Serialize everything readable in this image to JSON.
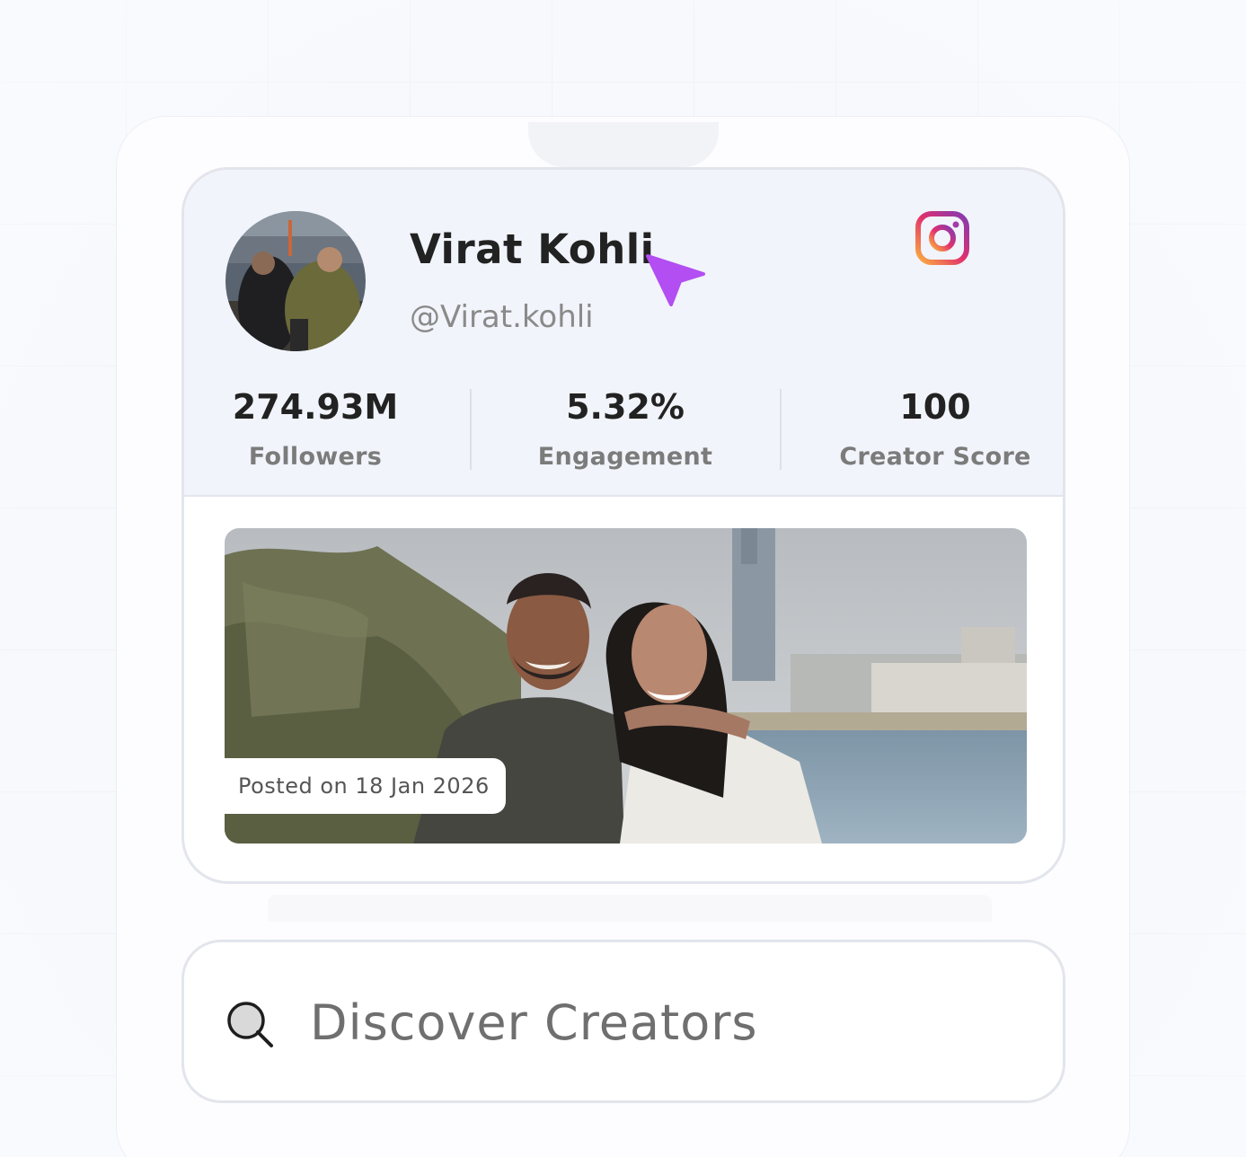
{
  "profile": {
    "name": "Virat Kohli",
    "handle": "@Virat.kohli",
    "platform_icon": "instagram-icon"
  },
  "stats": [
    {
      "value": "274.93M",
      "label": "Followers"
    },
    {
      "value": "5.32%",
      "label": "Engagement"
    },
    {
      "value": "100",
      "label": "Creator Score"
    }
  ],
  "post": {
    "posted_label": "Posted on 18 Jan 2026"
  },
  "search": {
    "placeholder": "Discover Creators",
    "icon": "search-icon"
  },
  "colors": {
    "cursor": "#b24ef2",
    "card_header_bg": "#f1f4fa",
    "instagram_gradient": [
      "#fbb040",
      "#e1306c",
      "#833ab4"
    ]
  }
}
